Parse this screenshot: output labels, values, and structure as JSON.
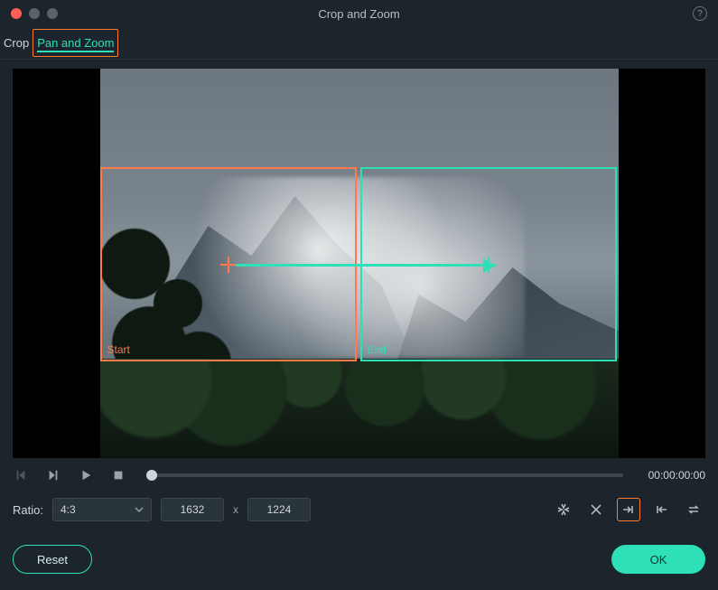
{
  "window": {
    "title": "Crop and Zoom"
  },
  "tabs": {
    "crop": "Crop",
    "panzoom": "Pan and Zoom"
  },
  "frames": {
    "start_label": "Start",
    "end_label": "End"
  },
  "playback": {
    "timecode": "00:00:00:00"
  },
  "ratio": {
    "label": "Ratio:",
    "selected": "4:3",
    "width": "1632",
    "height": "1224",
    "separator": "x"
  },
  "footer": {
    "reset": "Reset",
    "ok": "OK"
  }
}
